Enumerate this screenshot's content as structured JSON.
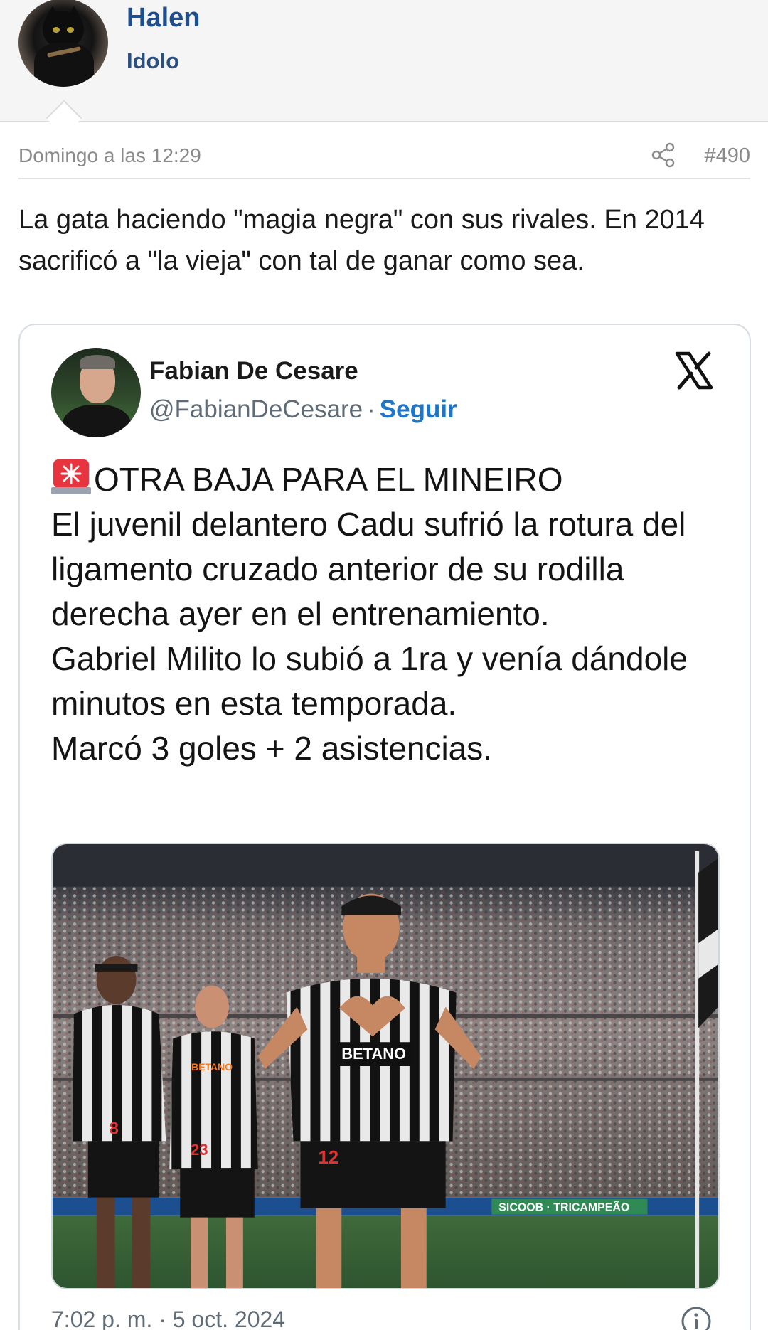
{
  "user": {
    "name": "Halen",
    "rank": "Idolo"
  },
  "post": {
    "date": "Domingo a las 12:29",
    "number": "#490",
    "text": "La gata haciendo \"magia negra\" con sus rivales. En 2014 sacrificó a \"la vieja\" con tal de ganar como sea.",
    "icons": {
      "share": "share-icon"
    }
  },
  "tweet": {
    "author_name": "Fabian De Cesare",
    "handle": "@FabianDeCesare",
    "separator": "·",
    "follow_label": "Seguir",
    "headline": "OTRA BAJA PARA EL MINEIRO",
    "lines": [
      "El juvenil delantero Cadu sufrió la rotura del ligamento cruzado anterior de su rodilla derecha ayer en el entrenamiento.",
      "Gabriel Milito lo subió a 1ra y venía dándole minutos en esta temporada.",
      "Marcó 3 goles + 2 asistencias."
    ],
    "timestamp": "7:02 p. m. · 5 oct. 2024",
    "photo_text": {
      "sponsor": "BETANO",
      "number_center": "12",
      "number_left": "8",
      "number_mid": "23",
      "ad_board": "SICOOB · TRICAMPEÃO"
    },
    "icons": {
      "siren": "siren-emoji-icon",
      "platform": "x-logo-icon",
      "info": "info-icon"
    }
  },
  "colors": {
    "username": "#1f4e8c",
    "link": "#1d76c9",
    "muted": "#8a8a8a",
    "header_bg": "#f5f5f5"
  }
}
